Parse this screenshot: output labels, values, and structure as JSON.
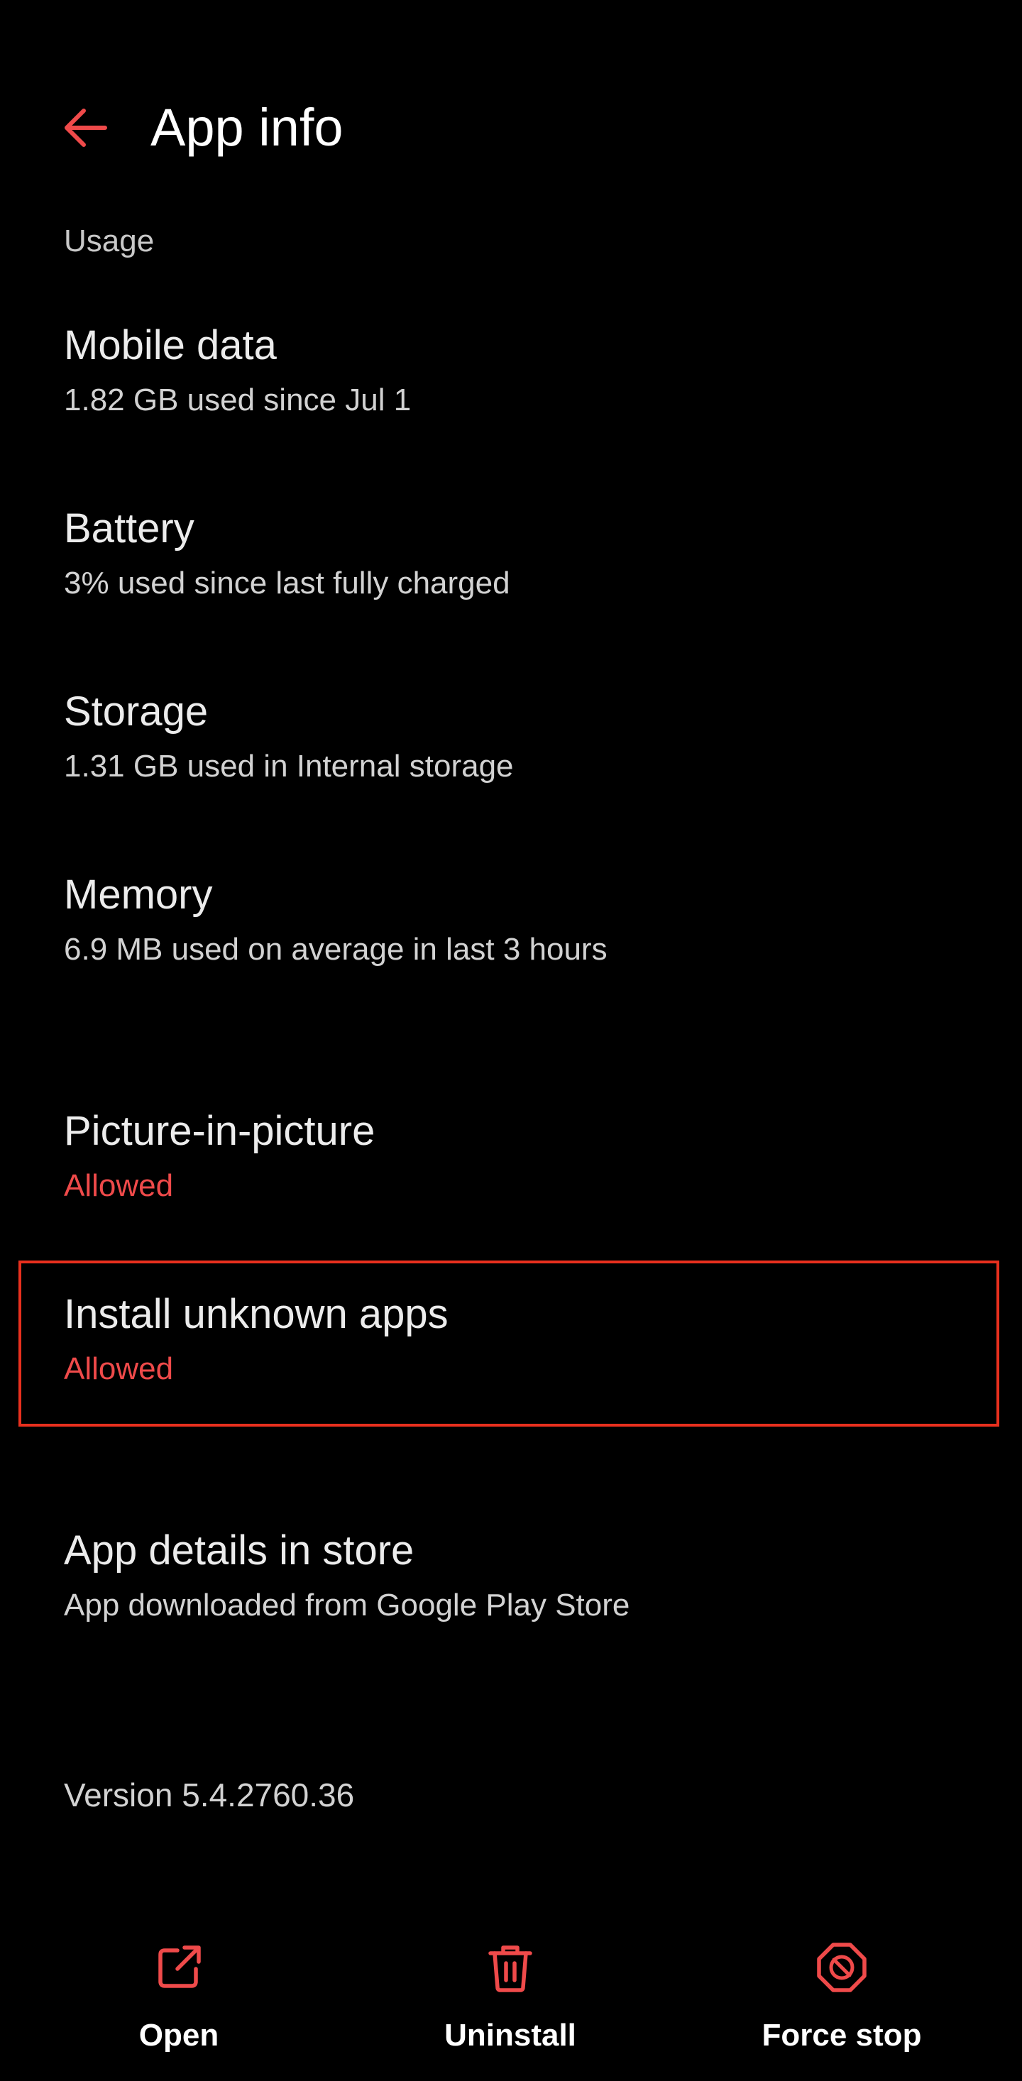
{
  "header": {
    "title": "App info"
  },
  "usage": {
    "section_label": "Usage",
    "items": [
      {
        "title": "Mobile data",
        "subtitle": "1.82 GB used since Jul 1"
      },
      {
        "title": "Battery",
        "subtitle": "3% used since last fully charged"
      },
      {
        "title": "Storage",
        "subtitle": "1.31 GB used in Internal storage"
      },
      {
        "title": "Memory",
        "subtitle": "6.9 MB used on average in last 3 hours"
      }
    ]
  },
  "advanced": {
    "items": [
      {
        "title": "Picture-in-picture",
        "subtitle": "Allowed"
      },
      {
        "title": "Install unknown apps",
        "subtitle": "Allowed"
      }
    ]
  },
  "store": {
    "title": "App details in store",
    "subtitle": "App downloaded from Google Play Store"
  },
  "version": "Version 5.4.2760.36",
  "actions": [
    {
      "label": "Open",
      "icon": "open-external-icon"
    },
    {
      "label": "Uninstall",
      "icon": "trash-icon"
    },
    {
      "label": "Force stop",
      "icon": "force-stop-icon"
    }
  ],
  "colors": {
    "background": "#000000",
    "accent": "#ef4a4a",
    "highlight_border": "#e8301e"
  }
}
